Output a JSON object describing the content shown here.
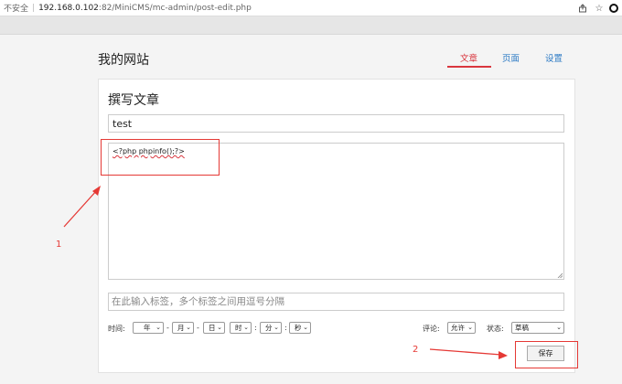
{
  "browser": {
    "insecure_label": "不安全",
    "url_host": "192.168.0.102",
    "url_path": ":82/MiniCMS/mc-admin/post-edit.php"
  },
  "site": {
    "title": "我的网站",
    "nav": [
      "文章",
      "页面",
      "设置"
    ],
    "active_nav": "文章"
  },
  "editor": {
    "heading": "撰写文章",
    "title_value": "test",
    "content_value": "<?php phpinfo();?>",
    "tags_placeholder": "在此输入标签，多个标签之间用逗号分隔"
  },
  "time": {
    "label": "时间:",
    "year": "年",
    "month": "月",
    "day": "日",
    "hour": "时",
    "minute": "分",
    "second": "秒",
    "date_sep": "-",
    "time_sep": ":"
  },
  "comment": {
    "label": "评论:",
    "value": "允许"
  },
  "status": {
    "label": "状态:",
    "value": "草稿"
  },
  "save_label": "保存",
  "annotations": [
    "1",
    "2"
  ],
  "colors": {
    "accent_red": "#d9363e",
    "link_blue": "#2e7bc5",
    "annotation": "#e53935"
  }
}
